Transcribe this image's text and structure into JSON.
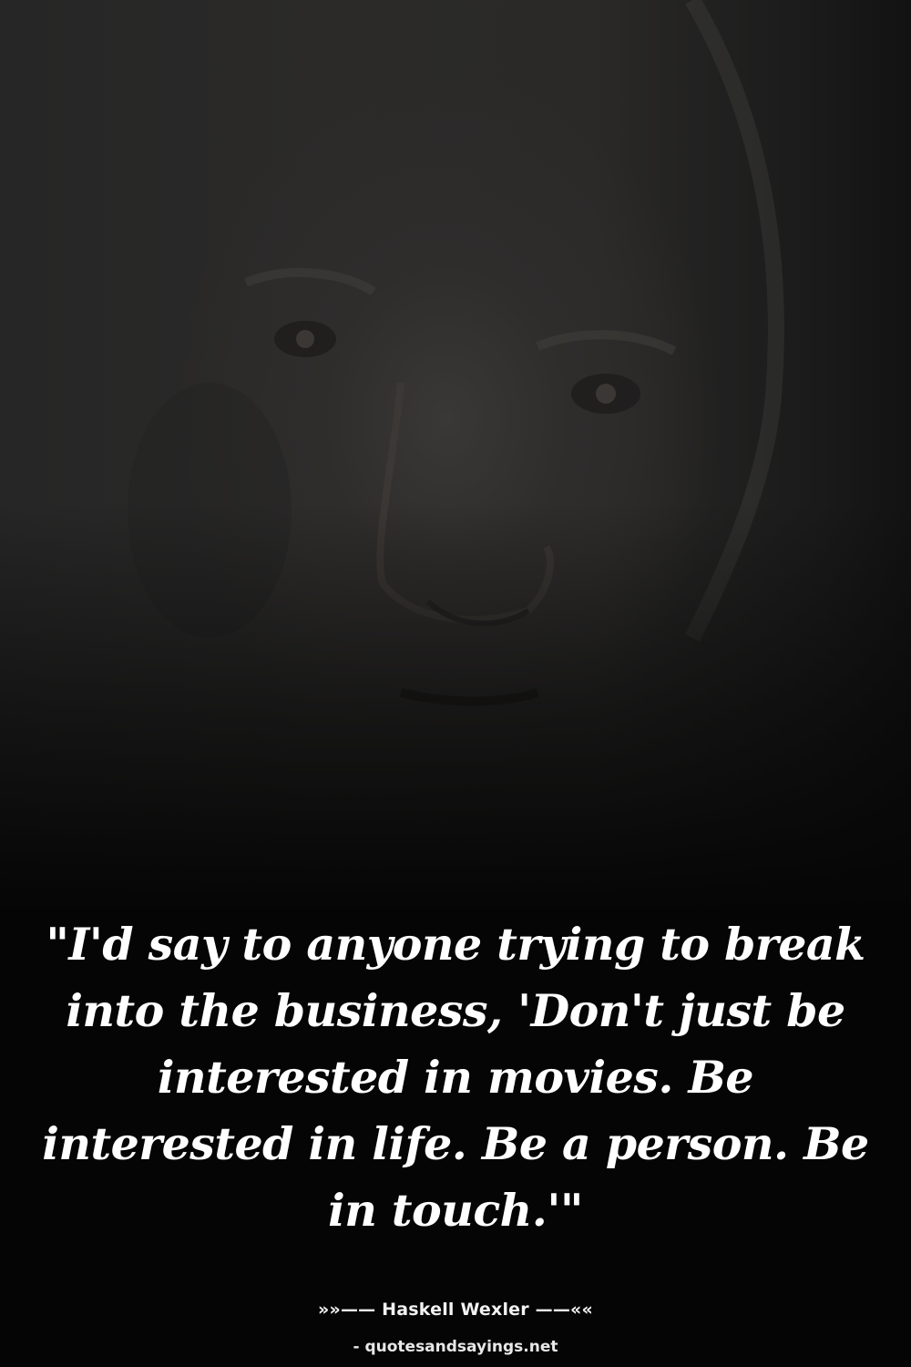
{
  "quote": {
    "text": "\"I'd say to anyone trying to break into the business, 'Don't just be interested in movies. Be interested in life. Be a person. Be in touch.'\""
  },
  "author": {
    "line": "»»—— Haskell Wexler ——««"
  },
  "source": {
    "text": "- quotesandsayings.net"
  },
  "colors": {
    "background": "#050505",
    "text": "#ffffff"
  }
}
